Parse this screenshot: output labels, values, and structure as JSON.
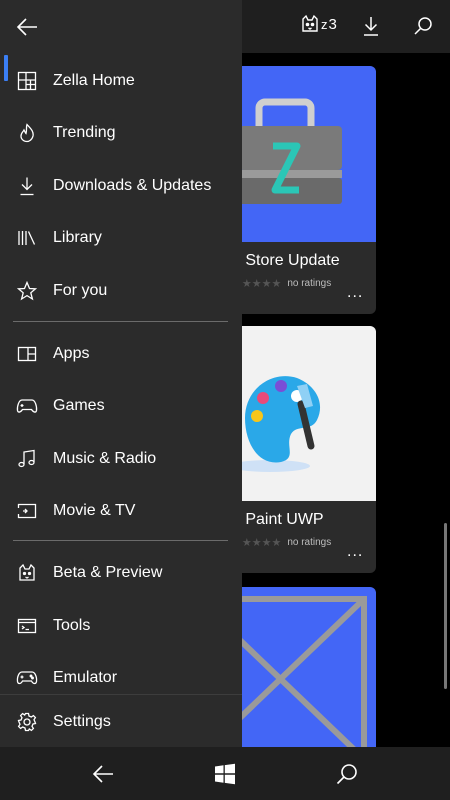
{
  "topbar": {
    "badge_count": "3"
  },
  "drawer": {
    "items": [
      {
        "label": "Zella Home",
        "icon": "home-grid-icon"
      },
      {
        "label": "Trending",
        "icon": "flame-icon"
      },
      {
        "label": "Downloads & Updates",
        "icon": "download-icon"
      },
      {
        "label": "Library",
        "icon": "library-icon"
      },
      {
        "label": "For you",
        "icon": "star-icon"
      },
      {
        "label": "Apps",
        "icon": "apps-icon"
      },
      {
        "label": "Games",
        "icon": "gamepad-icon"
      },
      {
        "label": "Music & Radio",
        "icon": "music-icon"
      },
      {
        "label": "Movie & TV",
        "icon": "movie-icon"
      },
      {
        "label": "Beta & Preview",
        "icon": "cat-icon"
      },
      {
        "label": "Tools",
        "icon": "console-icon"
      },
      {
        "label": "Emulator",
        "icon": "controller-icon"
      }
    ],
    "settings_label": "Settings",
    "selected": "Zella Home"
  },
  "cards": [
    {
      "title": "a Store Update",
      "rating_text": "no ratings",
      "more": "..."
    },
    {
      "title": "a Paint UWP",
      "rating_text": "no ratings",
      "more": "..."
    }
  ],
  "colors": {
    "accent": "#3b7ff5",
    "card_blue": "#4366f6",
    "drawer_bg": "#2b2b2b",
    "bar_bg": "#1f1f1f"
  }
}
